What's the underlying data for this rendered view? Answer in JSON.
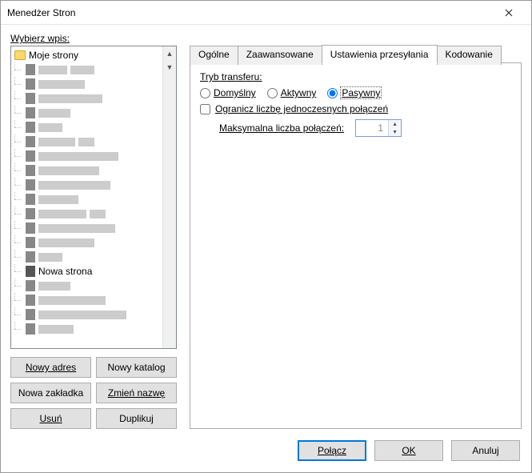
{
  "window": {
    "title": "Menedżer Stron"
  },
  "left": {
    "select_label": "Wybierz wpis:",
    "root_label": "Moje strony",
    "new_site_label": "Nowa strona",
    "buttons": {
      "new_site": "Nowy adres",
      "new_folder": "Nowy katalog",
      "new_bookmark": "Nowa zakładka",
      "rename": "Zmień nazwę",
      "delete": "Usuń",
      "duplicate": "Duplikuj"
    }
  },
  "tabs": {
    "general": "Ogólne",
    "advanced": "Zaawansowane",
    "transfer": "Ustawienia przesyłania",
    "charset": "Kodowanie",
    "active": "transfer"
  },
  "transfer": {
    "mode_label": "Tryb transferu:",
    "default": "Domyślny",
    "active": "Aktywny",
    "passive": "Pasywny",
    "selected": "passive",
    "limit_label": "Ogranicz liczbę jednoczesnych połączeń",
    "limit_checked": false,
    "max_label": "Maksymalna liczba połączeń:",
    "max_value": "1"
  },
  "footer": {
    "connect": "Połącz",
    "ok": "OK",
    "cancel": "Anuluj"
  }
}
